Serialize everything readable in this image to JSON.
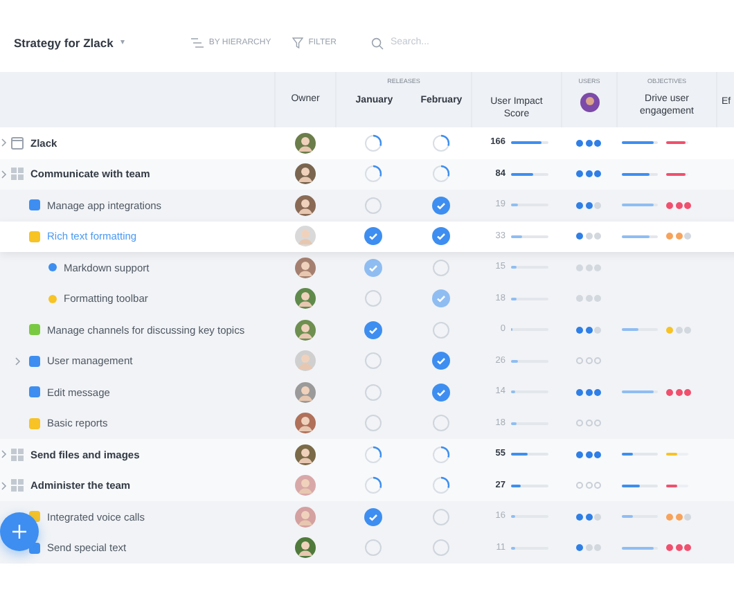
{
  "toolbar": {
    "title": "Strategy for Zlack",
    "caret": "▾",
    "group_button": "BY HIERARCHY",
    "filter_button": "FILTER",
    "search": {
      "placeholder": "Search..."
    }
  },
  "columns": {
    "owner": "Owner",
    "releases_group": "RELEASES",
    "january": "January",
    "february": "February",
    "score": "User Impact Score",
    "users_group": "USERS",
    "objectives_group": "OBJECTIVES",
    "objective": "Drive user engagement",
    "column_8": "Ef"
  },
  "rows": [
    {
      "kind": "root",
      "name": "Zlack",
      "expandable": true,
      "selected": false,
      "january": {
        "kind": "progress"
      },
      "february": {
        "kind": "progress"
      },
      "score": {
        "text": "166",
        "level": 0.8
      },
      "users": {
        "stars": 3
      },
      "engagement": {
        "level": 0.9
      },
      "second": {
        "kind": "bar",
        "color": "#f0506e",
        "level": 0.9
      }
    },
    {
      "kind": "goal",
      "name": "Communicate with team",
      "expandable": true,
      "selected": false,
      "january": {
        "kind": "progress"
      },
      "february": {
        "kind": "progress"
      },
      "score": {
        "text": "84",
        "level": 0.6
      },
      "users": {
        "stars": 3
      },
      "engagement": {
        "level": 0.75
      },
      "second": {
        "kind": "bar",
        "color": "#f0506e",
        "level": 0.9
      }
    },
    {
      "kind": "feature",
      "color": "#3d8ef0",
      "name": "Manage app integrations",
      "expandable": false,
      "selected": false,
      "january": {
        "kind": "empty"
      },
      "february": {
        "kind": "done"
      },
      "score": {
        "text": "19",
        "level": 0.2
      },
      "users": {
        "stars": 2
      },
      "engagement": {
        "level": 0.9
      },
      "second": {
        "kind": "dots",
        "color": "#f0506e",
        "stars": 3
      }
    },
    {
      "kind": "feature",
      "color": "#f7c325",
      "name": "Rich text formatting",
      "expandable": false,
      "selected": true,
      "january": {
        "kind": "done"
      },
      "february": {
        "kind": "done"
      },
      "score": {
        "text": "33",
        "level": 0.3
      },
      "users": {
        "stars": 1
      },
      "engagement": {
        "level": 0.75
      },
      "second": {
        "kind": "dots",
        "color": "#f7a35c",
        "stars": 2
      }
    },
    {
      "kind": "subfeature",
      "color": "#3d8ef0",
      "name": "Markdown support",
      "expandable": false,
      "selected": false,
      "january": {
        "kind": "done"
      },
      "february": {
        "kind": "empty"
      },
      "score": {
        "text": "15",
        "level": 0.15
      },
      "users": {
        "stars": 0
      }
    },
    {
      "kind": "subfeature",
      "color": "#f7c325",
      "name": "Formatting toolbar",
      "expandable": false,
      "selected": false,
      "january": {
        "kind": "empty"
      },
      "february": {
        "kind": "done"
      },
      "score": {
        "text": "18",
        "level": 0.15
      },
      "users": {
        "stars": 0
      }
    },
    {
      "kind": "feature",
      "color": "#7ac943",
      "name": "Manage channels for discussing key topics",
      "expandable": false,
      "selected": false,
      "january": {
        "kind": "done"
      },
      "february": {
        "kind": "empty"
      },
      "score": {
        "text": "0",
        "level": 0.05
      },
      "users": {
        "stars": 2
      },
      "engagement": {
        "level": 0.45
      },
      "second": {
        "kind": "dots",
        "color": "#f7c325",
        "stars": 1
      }
    },
    {
      "kind": "feature",
      "color": "#3d8ef0",
      "name": "User management",
      "expandable": true,
      "selected": false,
      "january": {
        "kind": "empty"
      },
      "february": {
        "kind": "done"
      },
      "score": {
        "text": "26",
        "level": 0.2
      },
      "users": {
        "stars": 0
      }
    },
    {
      "kind": "feature",
      "color": "#3d8ef0",
      "name": "Edit message",
      "expandable": false,
      "selected": false,
      "january": {
        "kind": "empty"
      },
      "february": {
        "kind": "done"
      },
      "score": {
        "text": "14",
        "level": 0.1
      },
      "users": {
        "stars": 3
      },
      "engagement": {
        "level": 0.9
      },
      "second": {
        "kind": "dots",
        "color": "#f0506e",
        "stars": 3
      }
    },
    {
      "kind": "feature",
      "color": "#f7c325",
      "name": "Basic reports",
      "expandable": false,
      "selected": false,
      "january": {
        "kind": "empty"
      },
      "february": {
        "kind": "empty"
      },
      "score": {
        "text": "18",
        "level": 0.15
      },
      "users": {
        "stars": 0
      }
    },
    {
      "kind": "goal",
      "name": "Send files and images",
      "expandable": true,
      "selected": false,
      "january": {
        "kind": "progress"
      },
      "february": {
        "kind": "progress"
      },
      "score": {
        "text": "55",
        "level": 0.45
      },
      "users": {
        "stars": 3
      },
      "engagement": {
        "level": 0.3
      },
      "second": {
        "kind": "bar",
        "color": "#f7c325",
        "level": 0.5
      }
    },
    {
      "kind": "goal",
      "name": "Administer the team",
      "expandable": true,
      "selected": false,
      "january": {
        "kind": "progress"
      },
      "february": {
        "kind": "progress"
      },
      "score": {
        "text": "27",
        "level": 0.25
      },
      "users": {
        "stars": 0
      },
      "engagement": {
        "level": 0.5
      },
      "second": {
        "kind": "bar",
        "color": "#f0506e",
        "level": 0.5
      }
    },
    {
      "kind": "feature",
      "color": "#f7c325",
      "name": "Integrated voice calls",
      "expandable": false,
      "selected": false,
      "january": {
        "kind": "done"
      },
      "february": {
        "kind": "empty"
      },
      "score": {
        "text": "16",
        "level": 0.1
      },
      "users": {
        "stars": 2
      },
      "engagement": {
        "level": 0.3
      },
      "second": {
        "kind": "dots",
        "color": "#f7a35c",
        "stars": 2
      }
    },
    {
      "kind": "feature",
      "color": "#3d8ef0",
      "name": "Send special text",
      "expandable": false,
      "selected": false,
      "january": {
        "kind": "empty"
      },
      "february": {
        "kind": "empty"
      },
      "score": {
        "text": "11",
        "level": 0.1
      },
      "users": {
        "stars": 1
      },
      "engagement": {
        "level": 0.9
      },
      "second": {
        "kind": "dots",
        "color": "#f0506e",
        "stars": 3
      }
    }
  ]
}
